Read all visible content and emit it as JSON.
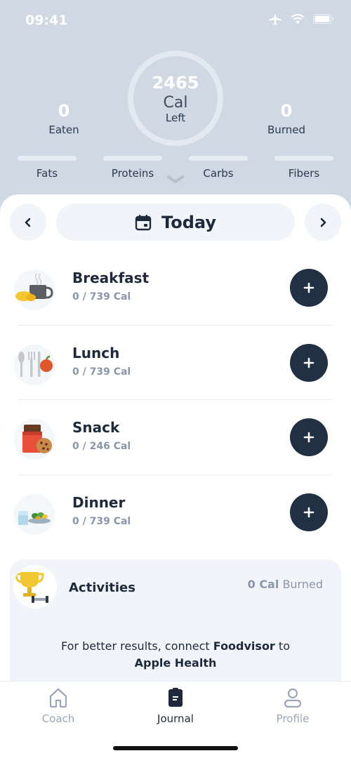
{
  "status": {
    "time": "09:41",
    "icons": [
      "airplane-icon",
      "wifi-icon",
      "battery-icon"
    ]
  },
  "summary": {
    "calories_left": "2465",
    "calories_unit": "Cal",
    "calories_left_label": "Left",
    "eaten_value": "0",
    "eaten_label": "Eaten",
    "burned_value": "0",
    "burned_label": "Burned",
    "macros": [
      {
        "label": "Fats"
      },
      {
        "label": "Proteins"
      },
      {
        "label": "Carbs"
      },
      {
        "label": "Fibers"
      }
    ]
  },
  "date_nav": {
    "label": "Today",
    "prev_icon": "chevron-left-icon",
    "next_icon": "chevron-right-icon"
  },
  "meals": [
    {
      "name": "Breakfast",
      "calories": "0 / 739 Cal",
      "icon": "breakfast-icon"
    },
    {
      "name": "Lunch",
      "calories": "0 / 739 Cal",
      "icon": "lunch-icon"
    },
    {
      "name": "Snack",
      "calories": "0 / 246 Cal",
      "icon": "snack-icon"
    },
    {
      "name": "Dinner",
      "calories": "0 / 739 Cal",
      "icon": "dinner-icon"
    }
  ],
  "activities": {
    "title": "Activities",
    "burned_value": "0 Cal",
    "burned_label": "Burned",
    "message_prefix": "For better results, connect ",
    "message_brand": "Foodvisor",
    "message_mid": " to ",
    "message_target": "Apple Health"
  },
  "tabs": [
    {
      "label": "Coach",
      "icon": "home-icon"
    },
    {
      "label": "Journal",
      "icon": "journal-icon",
      "active": true
    },
    {
      "label": "Profile",
      "icon": "profile-icon"
    }
  ],
  "colors": {
    "header_bg": "#cfd8e3",
    "dark_button": "#223044",
    "muted_text": "#8a97a8"
  }
}
